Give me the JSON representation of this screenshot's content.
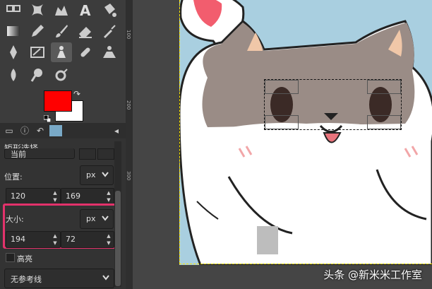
{
  "toolbox": {
    "tools": [
      {
        "name": "unified-transform-tool-icon"
      },
      {
        "name": "warp-transform-tool-icon"
      },
      {
        "name": "bucket-fill-tool-icon"
      },
      {
        "name": "text-tool-icon"
      },
      {
        "name": "paint-bucket-tool-icon"
      },
      {
        "name": "gradient-tool-icon"
      },
      {
        "name": "pencil-tool-icon"
      },
      {
        "name": "paintbrush-tool-icon"
      },
      {
        "name": "eraser-tool-icon"
      },
      {
        "name": "airbrush-tool-icon"
      },
      {
        "name": "ink-tool-icon"
      },
      {
        "name": "mypaint-brush-tool-icon"
      },
      {
        "name": "clone-tool-icon"
      },
      {
        "name": "heal-tool-icon"
      },
      {
        "name": "perspective-clone-tool-icon"
      },
      {
        "name": "blur-tool-icon"
      },
      {
        "name": "smudge-tool-icon"
      },
      {
        "name": "dodge-burn-tool-icon"
      }
    ],
    "fg_color": "#ff0000",
    "bg_color": "#ffffff"
  },
  "tool_options": {
    "title": "矩形选择",
    "mode_partial": "当前",
    "position_label": "位置:",
    "position_unit": "px",
    "position_x": "120",
    "position_y": "169",
    "size_label": "大小:",
    "size_unit": "px",
    "size_w": "194",
    "size_h": "72",
    "highlight_label": "高亮",
    "guides_value": "无参考线"
  },
  "ruler_marks": [
    "100",
    "200",
    "300"
  ],
  "watermark": "头条 @新米米工作室",
  "colors": {
    "highlight_box": "#e3326b",
    "selection": "#111111",
    "canvas_bg": "#a9cfe0"
  }
}
